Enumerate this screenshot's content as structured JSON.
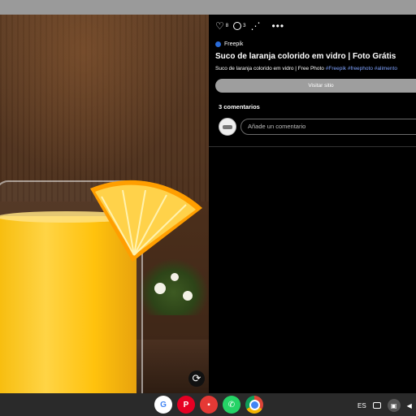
{
  "pin": {
    "likes": "8",
    "comments": "3",
    "source": "Freepik",
    "title": "Suco de laranja colorido em vidro | Foto Grátis",
    "description": "Suco de laranja colorido em vidro | Free Photo",
    "hashtags": [
      "#Freepik",
      "#freephoto",
      "#alimento"
    ],
    "visit_label": "Visitar sitio",
    "comments_header": "3 comentarios",
    "comment_placeholder": "Añade un comentario"
  },
  "shelf": {
    "apps": [
      "google",
      "pinterest",
      "keep",
      "whatsapp",
      "chrome"
    ],
    "language": "ES"
  },
  "icons": {
    "like": "heart-icon",
    "comment": "comment-icon",
    "share": "share-icon",
    "more": "more-icon",
    "lens": "visual-search-icon"
  },
  "colors": {
    "background": "#000000",
    "visit_button": "#9e9e9e",
    "hashtag": "#7fa3ff"
  }
}
